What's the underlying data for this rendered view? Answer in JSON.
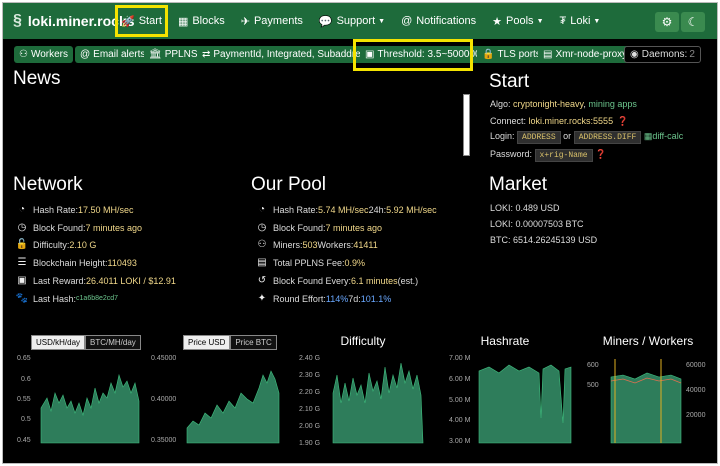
{
  "nav": {
    "brand": "loki.miner.rocks",
    "items": [
      {
        "label": "Start",
        "icon": "rocket-icon"
      },
      {
        "label": "Blocks",
        "icon": "cubes-icon"
      },
      {
        "label": "Payments",
        "icon": "paper-plane-icon"
      },
      {
        "label": "Support",
        "icon": "comments-icon"
      },
      {
        "label": "Notifications",
        "icon": "at-icon"
      },
      {
        "label": "Pools",
        "icon": "star-icon"
      },
      {
        "label": "Loki",
        "icon": "coin-icon"
      }
    ]
  },
  "badges": [
    {
      "label": "Workers",
      "icon": "users-icon"
    },
    {
      "label": "Email alerts",
      "icon": "at-icon"
    },
    {
      "label": "PPLNS",
      "icon": "bank-icon"
    },
    {
      "label": "PaymentId, Integrated, Subaddress",
      "icon": "exchange-icon"
    },
    {
      "label": "Threshold: 3.5~500000",
      "icon": "money-icon"
    },
    {
      "label": "TLS ports",
      "icon": "lock-icon"
    },
    {
      "label": "Xmr-node-proxy",
      "icon": "server-icon"
    },
    {
      "label": "Daemons:",
      "value": "2",
      "icon": "wifi-icon"
    }
  ],
  "news": {
    "title": "News"
  },
  "start": {
    "title": "Start",
    "algo_label": "Algo: ",
    "algo_value": "cryptonight-heavy",
    "algo_link": "mining apps",
    "connect_label": "Connect: ",
    "connect_value": "loki.miner.rocks:5555",
    "login_label": "Login:",
    "login_code1": "ADDRESS",
    "login_or": "or",
    "login_code2": "ADDRESS.DIFF",
    "login_link": "diff-calc",
    "password_label": "Password:",
    "password_code": "x+rig-Name"
  },
  "network": {
    "title": "Network",
    "hash_rate_label": "Hash Rate: ",
    "hash_rate_value": "17.50 MH/sec",
    "block_found_label": "Block Found: ",
    "block_found_value": "7 minutes ago",
    "difficulty_label": "Difficulty: ",
    "difficulty_value": "2.10 G",
    "height_label": "Blockchain Height: ",
    "height_value": "110493",
    "reward_label": "Last Reward: ",
    "reward_value": "26.4011 LOKI / $12.91",
    "last_hash_label": "Last Hash: ",
    "last_hash_value": "c1a6b8e2cd7"
  },
  "pool": {
    "title": "Our Pool",
    "hash_rate_label": "Hash Rate: ",
    "hash_rate_value": "5.74 MH/sec",
    "hash_24h_label": " 24h: ",
    "hash_24h_value": "5.92 MH/sec",
    "block_found_label": "Block Found: ",
    "block_found_value": "7 minutes ago",
    "miners_label": "Miners: ",
    "miners_value": "503",
    "workers_label": " Workers: ",
    "workers_value": "41411",
    "fee_label": "Total PPLNS Fee: ",
    "fee_value": "0.9%",
    "every_label": "Block Found Every: ",
    "every_value": "6.1 minutes",
    "every_suffix": " (est.)",
    "effort_label": "Round Effort: ",
    "effort_value": "114%",
    "effort_7d_label": " 7d: ",
    "effort_7d_value": "101.1%"
  },
  "market": {
    "title": "Market",
    "usd": "LOKI: 0.489 USD",
    "btc": "LOKI: 0.00007503 BTC",
    "btc_usd": "BTC: 6514.26245139 USD"
  },
  "charts": {
    "toggle1": [
      "USD/kH/day",
      "BTC/MH/day"
    ],
    "toggle2": [
      "Price USD",
      "Price BTC"
    ],
    "difficulty_title": "Difficulty",
    "hashrate_title": "Hashrate",
    "miners_title": "Miners / Workers",
    "ticks1": [
      "0.65",
      "0.6",
      "0.55",
      "0.5",
      "0.45"
    ],
    "ticks2": [
      "0.45000",
      "0.40000",
      "0.35000"
    ],
    "ticks3": [
      "2.40 G",
      "2.30 G",
      "2.20 G",
      "2.10 G",
      "2.00 G",
      "1.90 G"
    ],
    "ticks4": [
      "7.00 M",
      "6.00 M",
      "5.00 M",
      "4.00 M",
      "3.00 M"
    ],
    "ticks5a": [
      "600",
      "500"
    ],
    "ticks5b": [
      "60000",
      "40000",
      "20000"
    ]
  },
  "colors": {
    "nav": "#1e6b3b",
    "highlight": "#f4e300",
    "accent": "#f1d88a",
    "chart_fill": "#2e7d5b"
  }
}
